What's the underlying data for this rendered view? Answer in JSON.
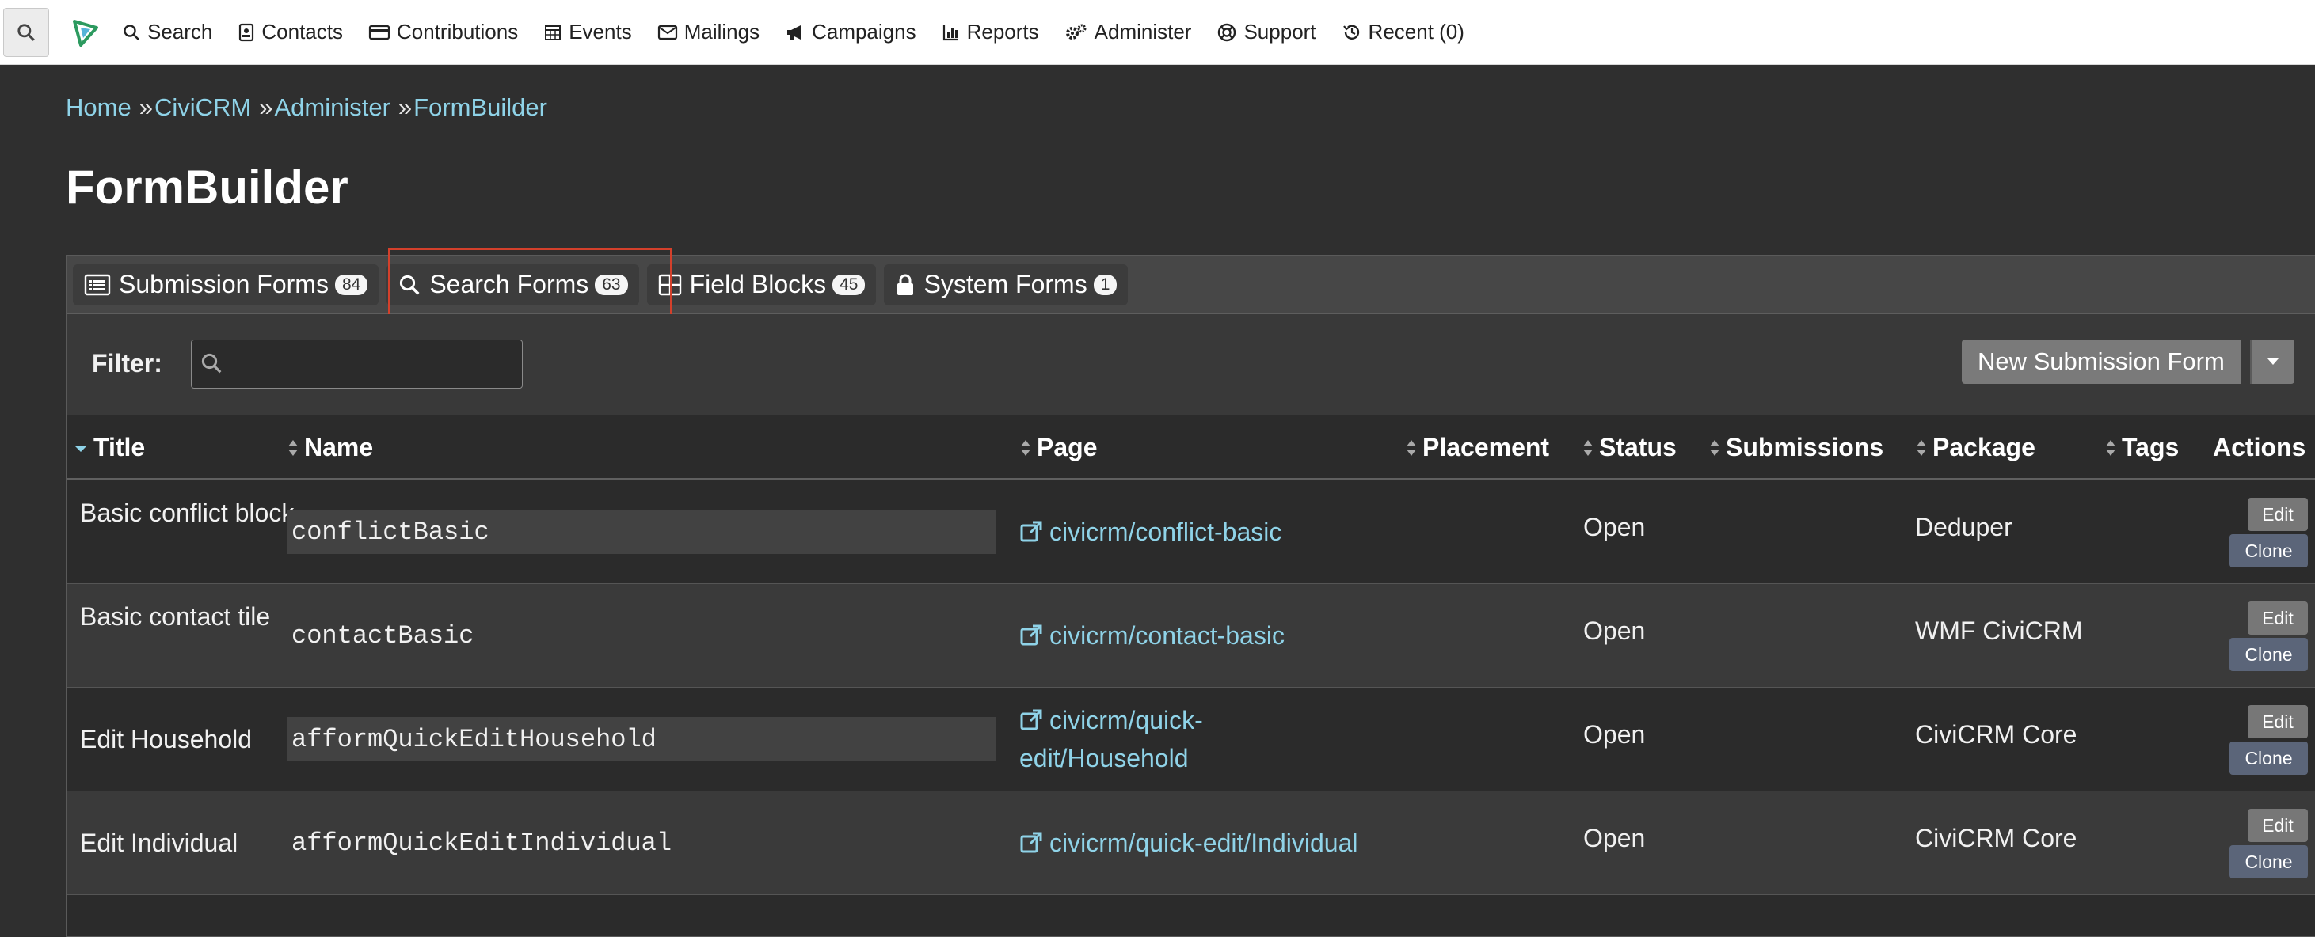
{
  "menubar": {
    "items": [
      {
        "label": "Search",
        "icon": "search-icon"
      },
      {
        "label": "Contacts",
        "icon": "address-card-icon"
      },
      {
        "label": "Contributions",
        "icon": "credit-card-icon"
      },
      {
        "label": "Events",
        "icon": "calendar-icon"
      },
      {
        "label": "Mailings",
        "icon": "envelope-icon"
      },
      {
        "label": "Campaigns",
        "icon": "bullhorn-icon"
      },
      {
        "label": "Reports",
        "icon": "bar-chart-icon"
      },
      {
        "label": "Administer",
        "icon": "cogs-icon"
      },
      {
        "label": "Support",
        "icon": "life-ring-icon"
      },
      {
        "label": "Recent (0)",
        "icon": "history-icon"
      }
    ]
  },
  "breadcrumb": {
    "items": [
      "Home",
      "CiviCRM",
      "Administer",
      "FormBuilder"
    ],
    "separator": "»"
  },
  "page": {
    "title": "FormBuilder"
  },
  "tabs": [
    {
      "label": "Submission Forms",
      "count": "84",
      "icon": "list-alt-icon"
    },
    {
      "label": "Search Forms",
      "count": "63",
      "icon": "search-icon"
    },
    {
      "label": "Field Blocks",
      "count": "45",
      "icon": "table-icon"
    },
    {
      "label": "System Forms",
      "count": "1",
      "icon": "lock-icon"
    }
  ],
  "filter": {
    "label": "Filter:",
    "placeholder": "",
    "value": ""
  },
  "actions": {
    "new_label": "New Submission Form"
  },
  "table": {
    "columns": [
      "Title",
      "Name",
      "Page",
      "Placement",
      "Status",
      "Submissions",
      "Package",
      "Tags",
      "Actions"
    ],
    "rows": [
      {
        "title": "Basic conflict block",
        "name": "conflictBasic",
        "page": "civicrm/conflict-basic",
        "placement": "",
        "status": "Open",
        "submissions": "",
        "package": "Deduper",
        "tags": "",
        "edit": "Edit",
        "clone": "Clone"
      },
      {
        "title": "Basic contact tile",
        "name": "contactBasic",
        "page": "civicrm/contact-basic",
        "placement": "",
        "status": "Open",
        "submissions": "",
        "package": "WMF CiviCRM",
        "tags": "",
        "edit": "Edit",
        "clone": "Clone"
      },
      {
        "title": "Edit Household",
        "name": "afformQuickEditHousehold",
        "page": "civicrm/quick-edit/Household",
        "placement": "",
        "status": "Open",
        "submissions": "",
        "package": "CiviCRM Core",
        "tags": "",
        "edit": "Edit",
        "clone": "Clone"
      },
      {
        "title": "Edit Individual",
        "name": "afformQuickEditIndividual",
        "page": "civicrm/quick-edit/Individual",
        "placement": "",
        "status": "Open",
        "submissions": "",
        "package": "CiviCRM Core",
        "tags": "",
        "edit": "Edit",
        "clone": "Clone"
      }
    ]
  },
  "colors": {
    "background": "#2f2f2f",
    "link": "#8fd3e8",
    "highlight": "#d4402b",
    "menubar": "#ffffff"
  }
}
